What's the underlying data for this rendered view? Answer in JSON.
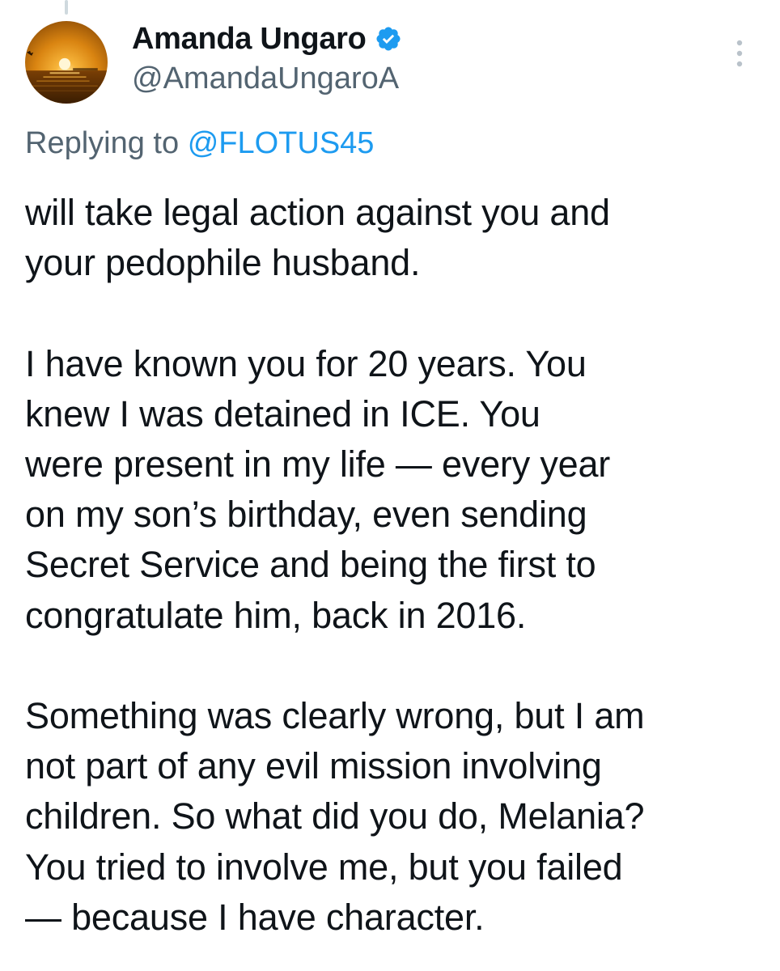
{
  "author": {
    "display_name": "Amanda Ungaro",
    "handle": "@AmandaUngaroA",
    "verified": true,
    "avatar_icon": "sunset-avatar-icon",
    "verified_icon": "verified-badge-icon"
  },
  "reply": {
    "prefix": "Replying to",
    "mention": "@FLOTUS45"
  },
  "menu": {
    "icon": "more-options-icon"
  },
  "tweet": {
    "paragraphs": [
      {
        "lines": [
          "will take legal action against you and",
          "your pedophile husband."
        ]
      },
      {
        "lines": [
          "I have known you for 20 years. You",
          "knew I was detained in ICE. You",
          "were present in my life — every year",
          "on my son’s birthday, even sending",
          "Secret Service and being the first to",
          "congratulate him, back in 2016."
        ]
      },
      {
        "lines": [
          "Something was clearly wrong, but I am",
          "not part of any evil mission involving",
          "children. So what did you do, Melania?",
          "You tried to involve me, but you failed",
          "— because I have character."
        ]
      }
    ]
  },
  "colors": {
    "text": "#0f1419",
    "secondary": "#536471",
    "link": "#1d9bf0",
    "verified": "#1d9bf0",
    "thread_line": "#cfd9de"
  }
}
